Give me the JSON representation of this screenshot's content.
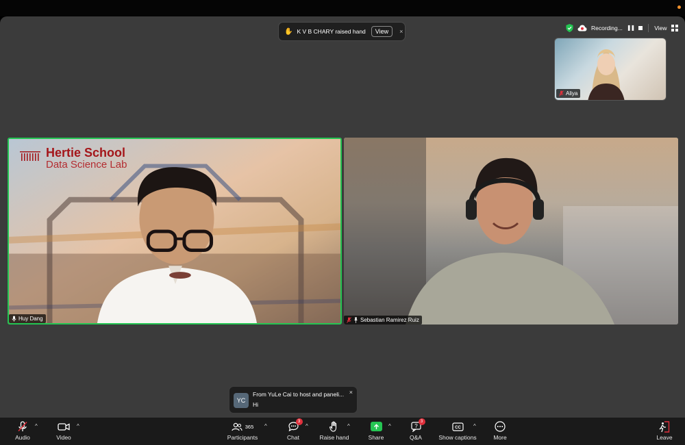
{
  "notice": {
    "text": "K V B CHARY raised hand",
    "button": "View",
    "close": "×"
  },
  "recording": {
    "label": "Recording...",
    "view": "View"
  },
  "self_view": {
    "name": "Aliya"
  },
  "tiles": [
    {
      "name": "Huy Dang",
      "brand_line1": "Hertie School",
      "brand_line2": "Data Science Lab",
      "active_speaker": true
    },
    {
      "name": "Sebastian Ramirez Ruiz"
    }
  ],
  "chat_toast": {
    "avatar": "YC",
    "from": "From YuLe Cai to host and paneli...",
    "message": "Hi",
    "close": "×"
  },
  "toolbar": {
    "audio": "Audio",
    "video": "Video",
    "participants": "Participants",
    "participants_count": "365",
    "chat": "Chat",
    "chat_badge": "3",
    "raise_hand": "Raise hand",
    "share": "Share",
    "qa": "Q&A",
    "qa_badge": "3",
    "captions": "Show captions",
    "more": "More",
    "leave": "Leave"
  },
  "colors": {
    "active_speaker_border": "#23c552",
    "badge": "#e0303c",
    "share": "#25c653",
    "brand": "#a4161a"
  }
}
